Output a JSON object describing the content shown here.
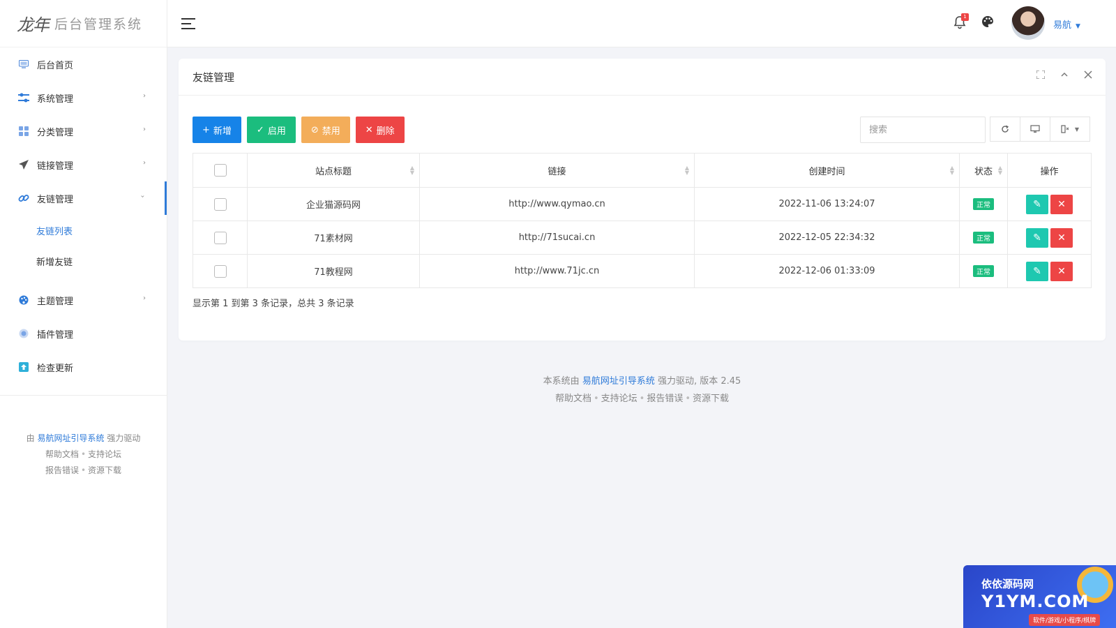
{
  "app": {
    "logo_mark": "龙年",
    "logo_text": "后台管理系统"
  },
  "sidebar": {
    "items": [
      {
        "label": "后台首页",
        "icon": "monitor-icon",
        "color": "#4b86d9"
      },
      {
        "label": "系统管理",
        "icon": "sliders-icon",
        "color": "#2f7bd9",
        "arrow": "›"
      },
      {
        "label": "分类管理",
        "icon": "grid-icon",
        "color": "#7aa5e6",
        "arrow": "›"
      },
      {
        "label": "链接管理",
        "icon": "paper-plane-icon",
        "color": "#555555",
        "arrow": "›"
      },
      {
        "label": "友链管理",
        "icon": "link-icon",
        "color": "#2f7bd9",
        "arrow": "›",
        "expanded": true
      },
      {
        "label": "主题管理",
        "icon": "palette-icon",
        "color": "#2f7bd9",
        "arrow": "›"
      },
      {
        "label": "插件管理",
        "icon": "plugin-icon",
        "color": "#7aa5e6"
      },
      {
        "label": "检查更新",
        "icon": "upload-icon",
        "color": "#2fb0d9"
      }
    ],
    "submenu": [
      {
        "label": "友链列表",
        "active": true
      },
      {
        "label": "新增友链",
        "active": false
      }
    ],
    "footer": {
      "prefix": "由",
      "link": "易航网址引导系统",
      "suffix": "强力驱动",
      "line2": [
        "帮助文档",
        "支持论坛"
      ],
      "line3": [
        "报告错误",
        "资源下载"
      ]
    }
  },
  "topbar": {
    "notification_count": "1",
    "username": "易航"
  },
  "panel": {
    "title": "友链管理",
    "buttons": {
      "add": "新增",
      "enable": "启用",
      "disable": "禁用",
      "delete": "删除"
    },
    "search_placeholder": "搜索",
    "columns": [
      "站点标题",
      "链接",
      "创建时间",
      "状态",
      "操作"
    ],
    "rows": [
      {
        "title": "企业猫源码网",
        "link": "http://www.qymao.cn",
        "created": "2022-11-06 13:24:07",
        "status": "正常"
      },
      {
        "title": "71素材网",
        "link": "http://71sucai.cn",
        "created": "2022-12-05 22:34:32",
        "status": "正常"
      },
      {
        "title": "71教程网",
        "link": "http://www.71jc.cn",
        "created": "2022-12-06 01:33:09",
        "status": "正常"
      }
    ],
    "summary": "显示第 1 到第 3 条记录，总共 3 条记录"
  },
  "footer": {
    "prefix": "本系统由",
    "link": "易航网址引导系统",
    "suffix": "强力驱动, 版本 2.45",
    "links": [
      "帮助文档",
      "支持论坛",
      "报告错误",
      "资源下载"
    ]
  },
  "watermark": {
    "top": "依依源码网",
    "main": "Y1YM.COM",
    "strip": "软件/游戏/小程序/棋牌"
  },
  "colors": {
    "primary": "#2f7bd9",
    "blue_button": "#1683e8",
    "green": "#1bbd7e",
    "orange": "#f3ad5a",
    "red": "#ed4545",
    "teal": "#1ec8b0"
  }
}
